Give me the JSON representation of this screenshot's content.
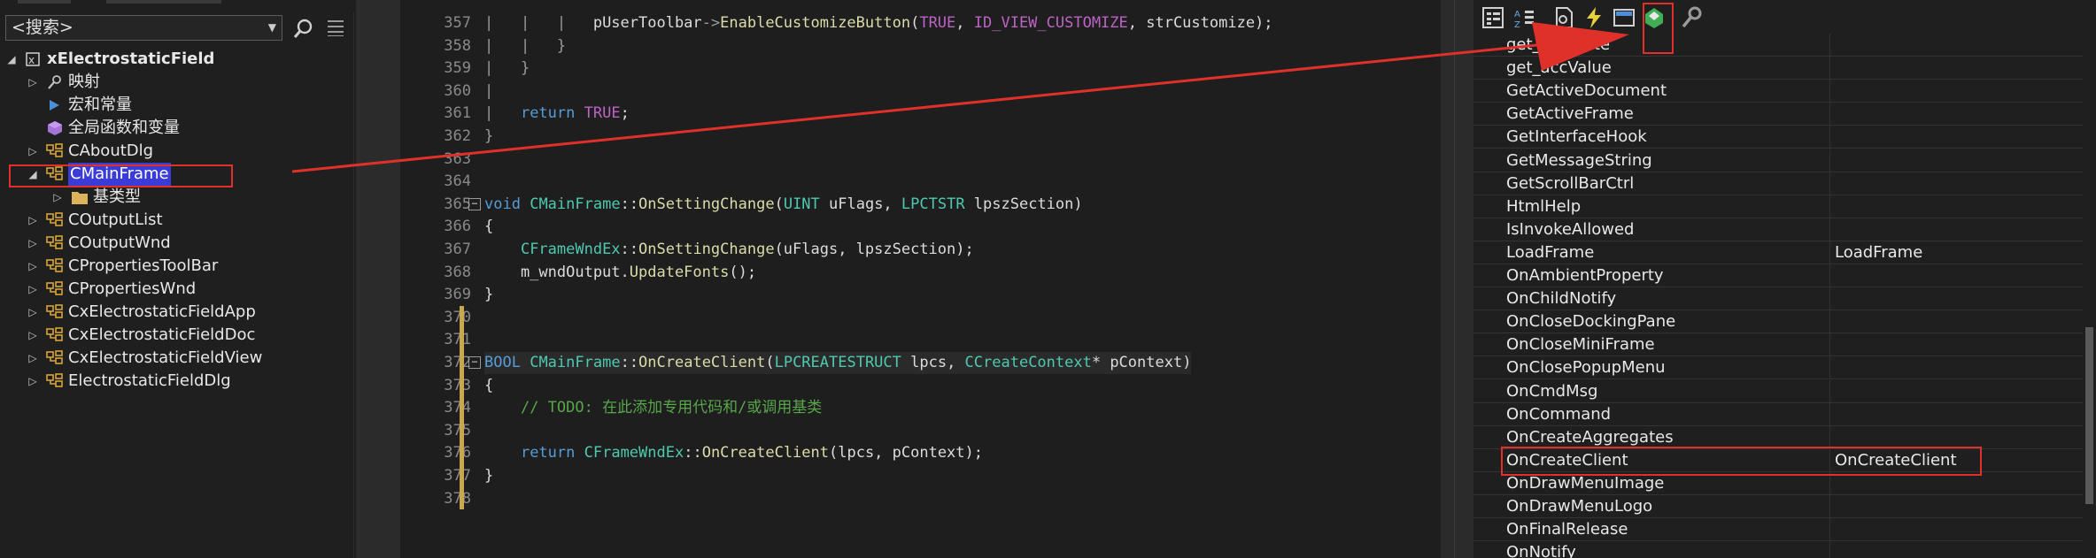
{
  "class_view": {
    "search_placeholder": "<搜索>",
    "tree": [
      {
        "label": "xElectrostaticField",
        "icon": "project-icon",
        "expander": "expanded",
        "level": 0,
        "bold": true
      },
      {
        "label": "映射",
        "icon": "map-icon",
        "expander": "collapsed",
        "level": 1
      },
      {
        "label": "宏和常量",
        "icon": "macro-icon",
        "expander": "none",
        "level": 1
      },
      {
        "label": "全局函数和变量",
        "icon": "globals-icon",
        "expander": "none",
        "level": 1
      },
      {
        "label": "CAboutDlg",
        "icon": "class-icon",
        "expander": "collapsed",
        "level": 1
      },
      {
        "label": "CMainFrame",
        "icon": "class-icon",
        "expander": "expanded",
        "level": 1,
        "selected": true
      },
      {
        "label": "基类型",
        "icon": "folder-icon",
        "expander": "collapsed",
        "level": 2
      },
      {
        "label": "COutputList",
        "icon": "class-icon",
        "expander": "collapsed",
        "level": 1
      },
      {
        "label": "COutputWnd",
        "icon": "class-icon",
        "expander": "collapsed",
        "level": 1
      },
      {
        "label": "CPropertiesToolBar",
        "icon": "class-icon",
        "expander": "collapsed",
        "level": 1
      },
      {
        "label": "CPropertiesWnd",
        "icon": "class-icon",
        "expander": "collapsed",
        "level": 1
      },
      {
        "label": "CxElectrostaticFieldApp",
        "icon": "class-icon",
        "expander": "collapsed",
        "level": 1
      },
      {
        "label": "CxElectrostaticFieldDoc",
        "icon": "class-icon",
        "expander": "collapsed",
        "level": 1
      },
      {
        "label": "CxElectrostaticFieldView",
        "icon": "class-icon",
        "expander": "collapsed",
        "level": 1
      },
      {
        "label": "ElectrostaticFieldDlg",
        "icon": "class-icon",
        "expander": "collapsed",
        "level": 1
      }
    ]
  },
  "editor": {
    "lines": [
      {
        "n": "357",
        "tokens": [
          [
            "pr",
            "|   |   |   "
          ],
          [
            "pl",
            "pUserToolbar"
          ],
          [
            "pr",
            "->"
          ],
          [
            "fn",
            "EnableCustomizeButton"
          ],
          [
            "pl",
            "("
          ],
          [
            "mc",
            "TRUE"
          ],
          [
            "pl",
            ", "
          ],
          [
            "mc",
            "ID_VIEW_CUSTOMIZE"
          ],
          [
            "pl",
            ", strCustomize);"
          ]
        ]
      },
      {
        "n": "358",
        "tokens": [
          [
            "pr",
            "|   |   }"
          ]
        ]
      },
      {
        "n": "359",
        "tokens": [
          [
            "pr",
            "|   }"
          ]
        ]
      },
      {
        "n": "360",
        "tokens": [
          [
            "pr",
            "|"
          ]
        ]
      },
      {
        "n": "361",
        "tokens": [
          [
            "pr",
            "|   "
          ],
          [
            "kw",
            "return"
          ],
          [
            "pl",
            " "
          ],
          [
            "mc",
            "TRUE"
          ],
          [
            "pl",
            ";"
          ]
        ]
      },
      {
        "n": "362",
        "tokens": [
          [
            "pr",
            "}"
          ]
        ]
      },
      {
        "n": "363",
        "tokens": []
      },
      {
        "n": "364",
        "tokens": []
      },
      {
        "n": "365",
        "fold": "−",
        "tokens": [
          [
            "kw",
            "void"
          ],
          [
            "pl",
            " "
          ],
          [
            "ty",
            "CMainFrame"
          ],
          [
            "pl",
            "::"
          ],
          [
            "fn",
            "OnSettingChange"
          ],
          [
            "pl",
            "("
          ],
          [
            "ty",
            "UINT"
          ],
          [
            "pl",
            " uFlags, "
          ],
          [
            "ty",
            "LPCTSTR"
          ],
          [
            "pl",
            " lpszSection)"
          ]
        ]
      },
      {
        "n": "366",
        "tokens": [
          [
            "pl",
            "{"
          ]
        ]
      },
      {
        "n": "367",
        "tokens": [
          [
            "pl",
            "    "
          ],
          [
            "ty",
            "CFrameWndEx"
          ],
          [
            "pl",
            "::"
          ],
          [
            "fn",
            "OnSettingChange"
          ],
          [
            "pl",
            "(uFlags, lpszSection);"
          ]
        ]
      },
      {
        "n": "368",
        "tokens": [
          [
            "pl",
            "    m_wndOutput."
          ],
          [
            "fn",
            "UpdateFonts"
          ],
          [
            "pl",
            "();"
          ]
        ]
      },
      {
        "n": "369",
        "tokens": [
          [
            "pl",
            "}"
          ]
        ]
      },
      {
        "n": "370",
        "tokens": []
      },
      {
        "n": "371",
        "tokens": []
      },
      {
        "n": "372",
        "fold": "−",
        "highlight": true,
        "tokens": [
          [
            "kw",
            "BOOL"
          ],
          [
            "pl",
            " "
          ],
          [
            "ty",
            "CMainFrame"
          ],
          [
            "pl",
            "::"
          ],
          [
            "fn",
            "OnCreateClient"
          ],
          [
            "pl",
            "("
          ],
          [
            "ty",
            "LPCREATESTRUCT"
          ],
          [
            "pl",
            " lpcs, "
          ],
          [
            "ty",
            "CCreateContext"
          ],
          [
            "pl",
            "* pContext)"
          ]
        ]
      },
      {
        "n": "373",
        "tokens": [
          [
            "pl",
            "{"
          ]
        ]
      },
      {
        "n": "374",
        "tokens": [
          [
            "pl",
            "    "
          ],
          [
            "cm",
            "// TODO: 在此添加专用代码和/或调用基类"
          ]
        ]
      },
      {
        "n": "375",
        "tokens": []
      },
      {
        "n": "376",
        "tokens": [
          [
            "pl",
            "    "
          ],
          [
            "kw",
            "return"
          ],
          [
            "pl",
            " "
          ],
          [
            "ty",
            "CFrameWndEx"
          ],
          [
            "pl",
            "::"
          ],
          [
            "fn",
            "OnCreateClient"
          ],
          [
            "pl",
            "(lpcs, pContext);"
          ]
        ]
      },
      {
        "n": "377",
        "tokens": [
          [
            "pl",
            "}"
          ]
        ]
      },
      {
        "n": "378",
        "tokens": []
      }
    ]
  },
  "properties": {
    "toolbar": [
      {
        "name": "categorized-icon"
      },
      {
        "name": "alphabetical-icon"
      },
      {
        "name": "properties-page-icon"
      },
      {
        "name": "events-icon"
      },
      {
        "name": "messages-icon"
      },
      {
        "name": "overrides-icon",
        "active": true
      },
      {
        "name": "property-pages-key-icon"
      }
    ],
    "rows": [
      {
        "name": "get_accState",
        "value": ""
      },
      {
        "name": "get_accValue",
        "value": ""
      },
      {
        "name": "GetActiveDocument",
        "value": ""
      },
      {
        "name": "GetActiveFrame",
        "value": ""
      },
      {
        "name": "GetInterfaceHook",
        "value": ""
      },
      {
        "name": "GetMessageString",
        "value": ""
      },
      {
        "name": "GetScrollBarCtrl",
        "value": ""
      },
      {
        "name": "HtmlHelp",
        "value": ""
      },
      {
        "name": "IsInvokeAllowed",
        "value": ""
      },
      {
        "name": "LoadFrame",
        "value": "LoadFrame"
      },
      {
        "name": "OnAmbientProperty",
        "value": ""
      },
      {
        "name": "OnChildNotify",
        "value": ""
      },
      {
        "name": "OnCloseDockingPane",
        "value": ""
      },
      {
        "name": "OnCloseMiniFrame",
        "value": ""
      },
      {
        "name": "OnClosePopupMenu",
        "value": ""
      },
      {
        "name": "OnCmdMsg",
        "value": ""
      },
      {
        "name": "OnCommand",
        "value": ""
      },
      {
        "name": "OnCreateAggregates",
        "value": ""
      },
      {
        "name": "OnCreateClient",
        "value": "OnCreateClient",
        "annotated": true
      },
      {
        "name": "OnDrawMenuImage",
        "value": ""
      },
      {
        "name": "OnDrawMenuLogo",
        "value": ""
      },
      {
        "name": "OnFinalRelease",
        "value": ""
      },
      {
        "name": "OnNotify",
        "value": ""
      }
    ]
  },
  "colors": {
    "annotation": "#e0302a",
    "selection": "#3b3bd6",
    "class_icon": "#d7a43a",
    "folder_icon": "#dcb25a"
  }
}
